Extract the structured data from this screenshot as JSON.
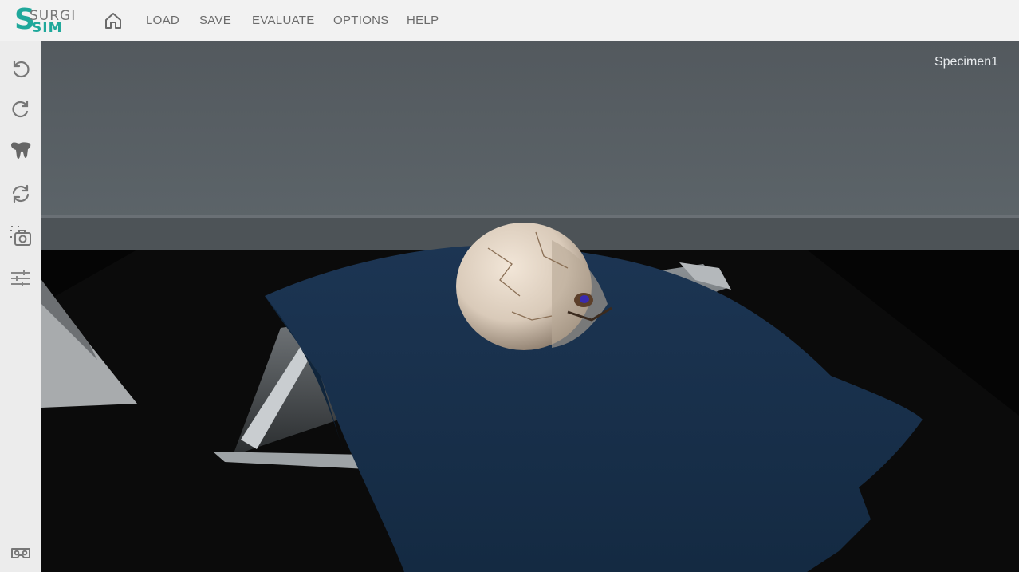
{
  "app": {
    "logo_top": "SURGI",
    "logo_bottom": "SIM",
    "logo_mark": "S"
  },
  "nav": {
    "home_icon": "home-icon",
    "items": [
      "LOAD",
      "SAVE",
      "EVALUATE",
      "OPTIONS",
      "HELP"
    ]
  },
  "sidebar": {
    "tools": [
      "undo-icon",
      "redo-icon",
      "tooth-icon",
      "rotate-view-icon",
      "screenshot-icon",
      "sliders-icon"
    ],
    "bottom_tool": "vr-headset-icon"
  },
  "viewport": {
    "specimen_label": "Specimen1"
  },
  "colors": {
    "brand": "#1fa89b",
    "menu_text": "#6b6b6b",
    "topbar_bg": "#f2f2f2",
    "sidebar_bg": "#ececec",
    "towel": "#1b3350"
  }
}
